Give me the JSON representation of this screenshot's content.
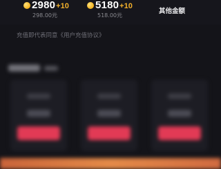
{
  "recharge_options": [
    {
      "amount": "2980",
      "bonus": "+10",
      "price": "298.00元",
      "icon": "gold-coin-icon"
    },
    {
      "amount": "5180",
      "bonus": "+10",
      "price": "518.00元",
      "icon": "gold-coin-icon"
    }
  ],
  "other_amount_label": "其他金额",
  "agreement_text": "充值即代表同意《用户充值协议》",
  "colors": {
    "background": "#141419",
    "bonus": "#f3b12b",
    "button": "#e23a55",
    "price": "#8a8a90"
  }
}
